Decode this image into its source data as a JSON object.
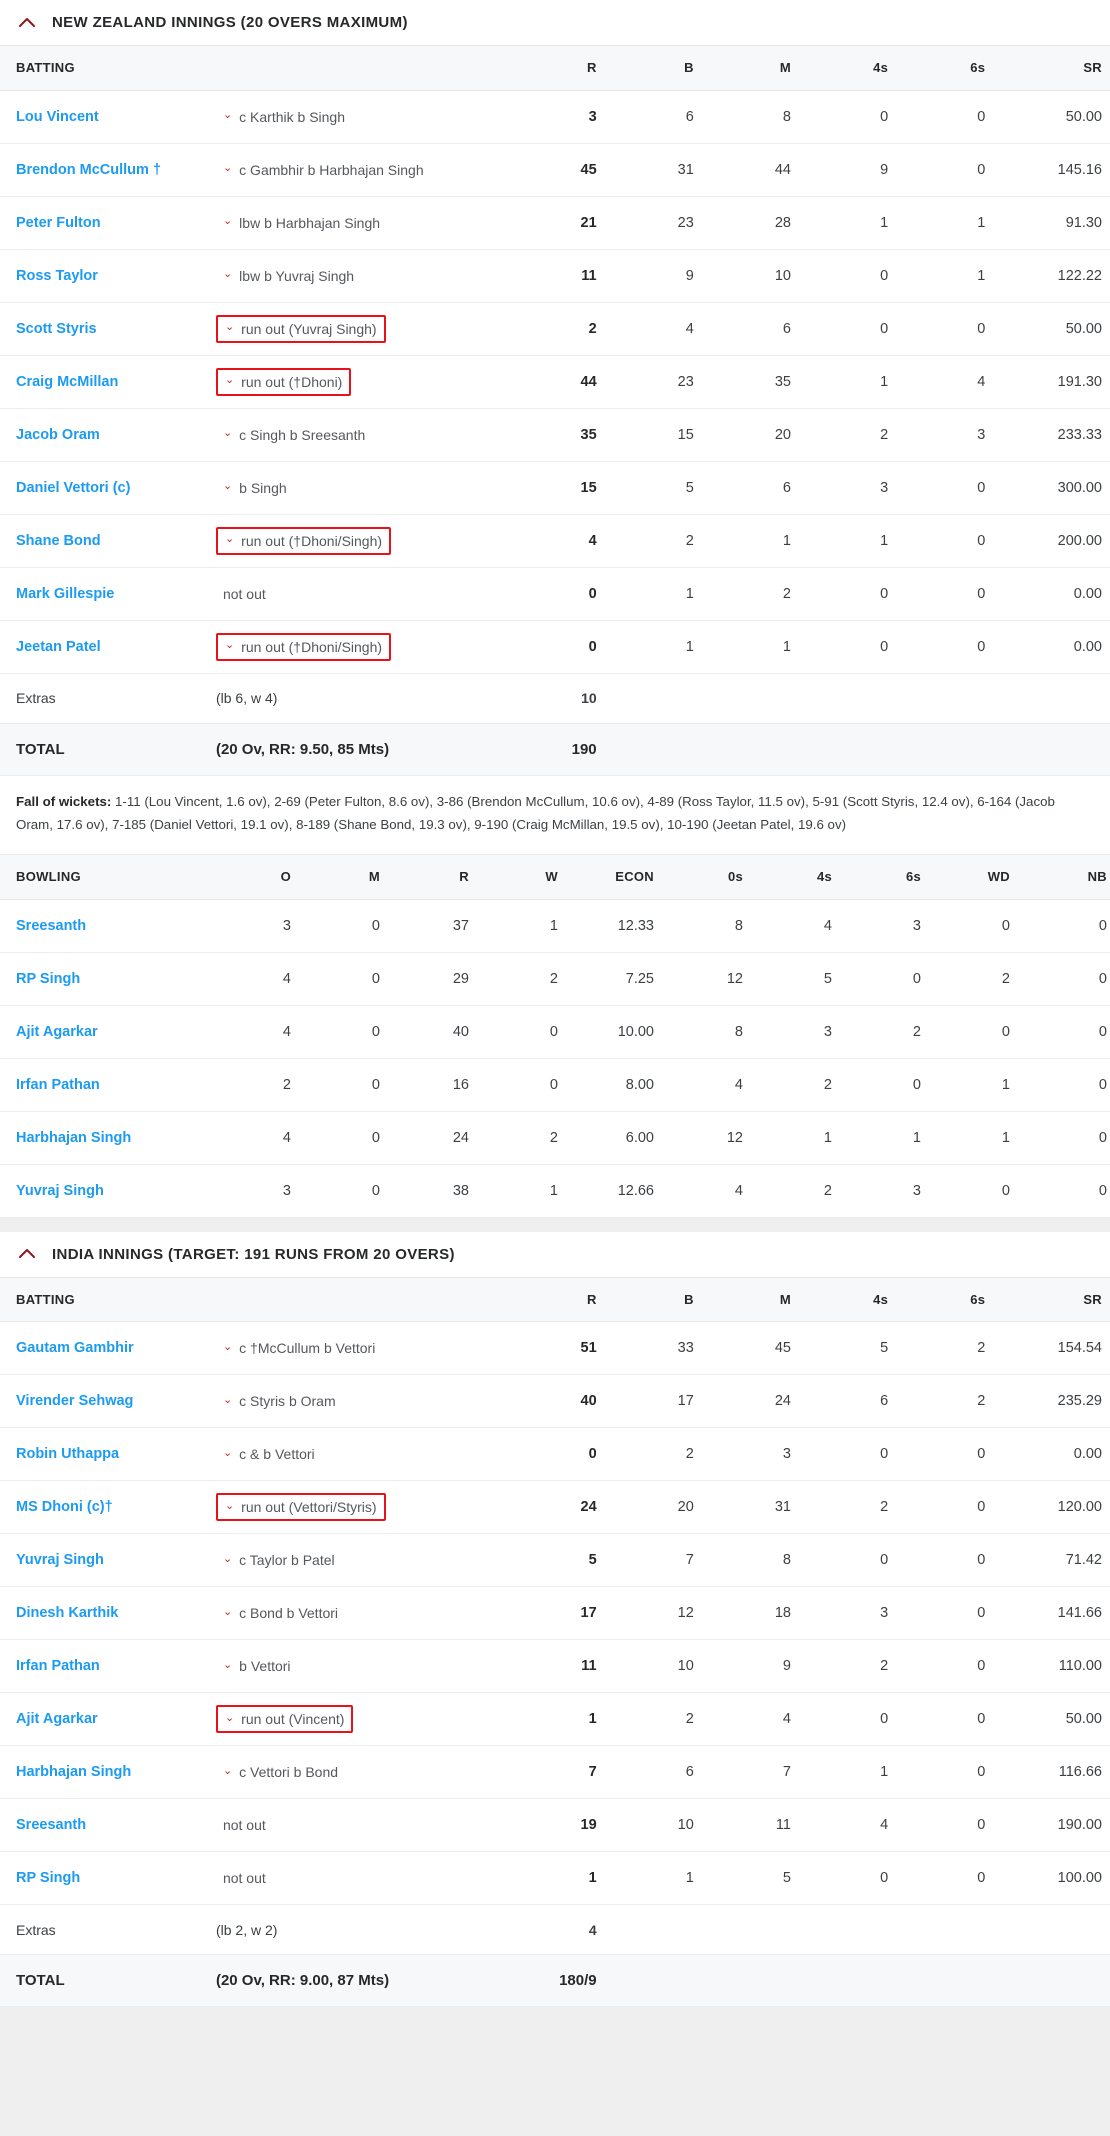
{
  "colors": {
    "link": "#1d9bf0",
    "annotation_box": "#e8121a",
    "caret": "#c0272d",
    "header_bg": "#f7f8fa",
    "chevron": "#8b1a20"
  },
  "icons": {
    "collapse": "chevron-up-icon",
    "dismissal": "caret-down-icon"
  },
  "batting_columns": [
    "BATTING",
    "R",
    "B",
    "M",
    "4s",
    "6s",
    "SR"
  ],
  "bowling_columns": [
    "BOWLING",
    "O",
    "M",
    "R",
    "W",
    "ECON",
    "0s",
    "4s",
    "6s",
    "WD",
    "NB"
  ],
  "innings": [
    {
      "title": "NEW ZEALAND INNINGS (20 OVERS MAXIMUM)",
      "batting": [
        {
          "player": "Lou Vincent",
          "dismissal": "c Karthik b Singh",
          "boxed": false,
          "r": "3",
          "b": "6",
          "m": "8",
          "fours": "0",
          "sixes": "0",
          "sr": "50.00"
        },
        {
          "player": "Brendon McCullum †",
          "dismissal": "c Gambhir b Harbhajan Singh",
          "boxed": false,
          "r": "45",
          "b": "31",
          "m": "44",
          "fours": "9",
          "sixes": "0",
          "sr": "145.16"
        },
        {
          "player": "Peter Fulton",
          "dismissal": "lbw b Harbhajan Singh",
          "boxed": false,
          "r": "21",
          "b": "23",
          "m": "28",
          "fours": "1",
          "sixes": "1",
          "sr": "91.30"
        },
        {
          "player": "Ross Taylor",
          "dismissal": "lbw b Yuvraj Singh",
          "boxed": false,
          "r": "11",
          "b": "9",
          "m": "10",
          "fours": "0",
          "sixes": "1",
          "sr": "122.22"
        },
        {
          "player": "Scott Styris",
          "dismissal": "run out (Yuvraj Singh)",
          "boxed": true,
          "r": "2",
          "b": "4",
          "m": "6",
          "fours": "0",
          "sixes": "0",
          "sr": "50.00"
        },
        {
          "player": "Craig McMillan",
          "dismissal": "run out (†Dhoni)",
          "boxed": true,
          "r": "44",
          "b": "23",
          "m": "35",
          "fours": "1",
          "sixes": "4",
          "sr": "191.30"
        },
        {
          "player": "Jacob Oram",
          "dismissal": "c Singh b Sreesanth",
          "boxed": false,
          "r": "35",
          "b": "15",
          "m": "20",
          "fours": "2",
          "sixes": "3",
          "sr": "233.33"
        },
        {
          "player": "Daniel Vettori (c)",
          "dismissal": "b Singh",
          "boxed": false,
          "r": "15",
          "b": "5",
          "m": "6",
          "fours": "3",
          "sixes": "0",
          "sr": "300.00"
        },
        {
          "player": "Shane Bond",
          "dismissal": "run out (†Dhoni/Singh)",
          "boxed": true,
          "r": "4",
          "b": "2",
          "m": "1",
          "fours": "1",
          "sixes": "0",
          "sr": "200.00"
        },
        {
          "player": "Mark Gillespie",
          "dismissal": "not out",
          "boxed": false,
          "nocaret": true,
          "r": "0",
          "b": "1",
          "m": "2",
          "fours": "0",
          "sixes": "0",
          "sr": "0.00"
        },
        {
          "player": "Jeetan Patel",
          "dismissal": "run out (†Dhoni/Singh)",
          "boxed": true,
          "r": "0",
          "b": "1",
          "m": "1",
          "fours": "0",
          "sixes": "0",
          "sr": "0.00"
        }
      ],
      "extras": {
        "label": "Extras",
        "detail": "(lb 6, w 4)",
        "value": "10"
      },
      "total": {
        "label": "TOTAL",
        "detail": "(20 Ov, RR: 9.50, 85 Mts)",
        "value": "190"
      },
      "fall_of_wickets_label": "Fall of wickets:",
      "fall_of_wickets": "1-11 (Lou Vincent, 1.6 ov), 2-69 (Peter Fulton, 8.6 ov), 3-86 (Brendon McCullum, 10.6 ov), 4-89 (Ross Taylor, 11.5 ov), 5-91 (Scott Styris, 12.4 ov), 6-164 (Jacob Oram, 17.6 ov), 7-185 (Daniel Vettori, 19.1 ov), 8-189 (Shane Bond, 19.3 ov), 9-190 (Craig McMillan, 19.5 ov), 10-190 (Jeetan Patel, 19.6 ov)",
      "bowling": [
        {
          "bowler": "Sreesanth",
          "o": "3",
          "m": "0",
          "r": "37",
          "w": "1",
          "econ": "12.33",
          "zeros": "8",
          "fours": "4",
          "sixes": "3",
          "wd": "0",
          "nb": "0"
        },
        {
          "bowler": "RP Singh",
          "o": "4",
          "m": "0",
          "r": "29",
          "w": "2",
          "econ": "7.25",
          "zeros": "12",
          "fours": "5",
          "sixes": "0",
          "wd": "2",
          "nb": "0"
        },
        {
          "bowler": "Ajit Agarkar",
          "o": "4",
          "m": "0",
          "r": "40",
          "w": "0",
          "econ": "10.00",
          "zeros": "8",
          "fours": "3",
          "sixes": "2",
          "wd": "0",
          "nb": "0"
        },
        {
          "bowler": "Irfan Pathan",
          "o": "2",
          "m": "0",
          "r": "16",
          "w": "0",
          "econ": "8.00",
          "zeros": "4",
          "fours": "2",
          "sixes": "0",
          "wd": "1",
          "nb": "0"
        },
        {
          "bowler": "Harbhajan Singh",
          "o": "4",
          "m": "0",
          "r": "24",
          "w": "2",
          "econ": "6.00",
          "zeros": "12",
          "fours": "1",
          "sixes": "1",
          "wd": "1",
          "nb": "0"
        },
        {
          "bowler": "Yuvraj Singh",
          "o": "3",
          "m": "0",
          "r": "38",
          "w": "1",
          "econ": "12.66",
          "zeros": "4",
          "fours": "2",
          "sixes": "3",
          "wd": "0",
          "nb": "0"
        }
      ]
    },
    {
      "title": "INDIA INNINGS (TARGET: 191 RUNS FROM 20 OVERS)",
      "batting": [
        {
          "player": "Gautam Gambhir",
          "dismissal": "c †McCullum b Vettori",
          "boxed": false,
          "r": "51",
          "b": "33",
          "m": "45",
          "fours": "5",
          "sixes": "2",
          "sr": "154.54"
        },
        {
          "player": "Virender Sehwag",
          "dismissal": "c Styris b Oram",
          "boxed": false,
          "r": "40",
          "b": "17",
          "m": "24",
          "fours": "6",
          "sixes": "2",
          "sr": "235.29"
        },
        {
          "player": "Robin Uthappa",
          "dismissal": "c & b Vettori",
          "boxed": false,
          "r": "0",
          "b": "2",
          "m": "3",
          "fours": "0",
          "sixes": "0",
          "sr": "0.00"
        },
        {
          "player": "MS Dhoni (c)†",
          "dismissal": "run out (Vettori/Styris)",
          "boxed": true,
          "r": "24",
          "b": "20",
          "m": "31",
          "fours": "2",
          "sixes": "0",
          "sr": "120.00"
        },
        {
          "player": "Yuvraj Singh",
          "dismissal": "c Taylor b Patel",
          "boxed": false,
          "r": "5",
          "b": "7",
          "m": "8",
          "fours": "0",
          "sixes": "0",
          "sr": "71.42"
        },
        {
          "player": "Dinesh Karthik",
          "dismissal": "c Bond b Vettori",
          "boxed": false,
          "r": "17",
          "b": "12",
          "m": "18",
          "fours": "3",
          "sixes": "0",
          "sr": "141.66"
        },
        {
          "player": "Irfan Pathan",
          "dismissal": "b Vettori",
          "boxed": false,
          "r": "11",
          "b": "10",
          "m": "9",
          "fours": "2",
          "sixes": "0",
          "sr": "110.00"
        },
        {
          "player": "Ajit Agarkar",
          "dismissal": "run out (Vincent)",
          "boxed": true,
          "r": "1",
          "b": "2",
          "m": "4",
          "fours": "0",
          "sixes": "0",
          "sr": "50.00"
        },
        {
          "player": "Harbhajan Singh",
          "dismissal": "c Vettori b Bond",
          "boxed": false,
          "r": "7",
          "b": "6",
          "m": "7",
          "fours": "1",
          "sixes": "0",
          "sr": "116.66"
        },
        {
          "player": "Sreesanth",
          "dismissal": "not out",
          "boxed": false,
          "nocaret": true,
          "r": "19",
          "b": "10",
          "m": "11",
          "fours": "4",
          "sixes": "0",
          "sr": "190.00"
        },
        {
          "player": "RP Singh",
          "dismissal": "not out",
          "boxed": false,
          "nocaret": true,
          "r": "1",
          "b": "1",
          "m": "5",
          "fours": "0",
          "sixes": "0",
          "sr": "100.00"
        }
      ],
      "extras": {
        "label": "Extras",
        "detail": "(lb 2, w 2)",
        "value": "4"
      },
      "total": {
        "label": "TOTAL",
        "detail": "(20 Ov, RR: 9.00, 87 Mts)",
        "value": "180/9"
      }
    }
  ]
}
